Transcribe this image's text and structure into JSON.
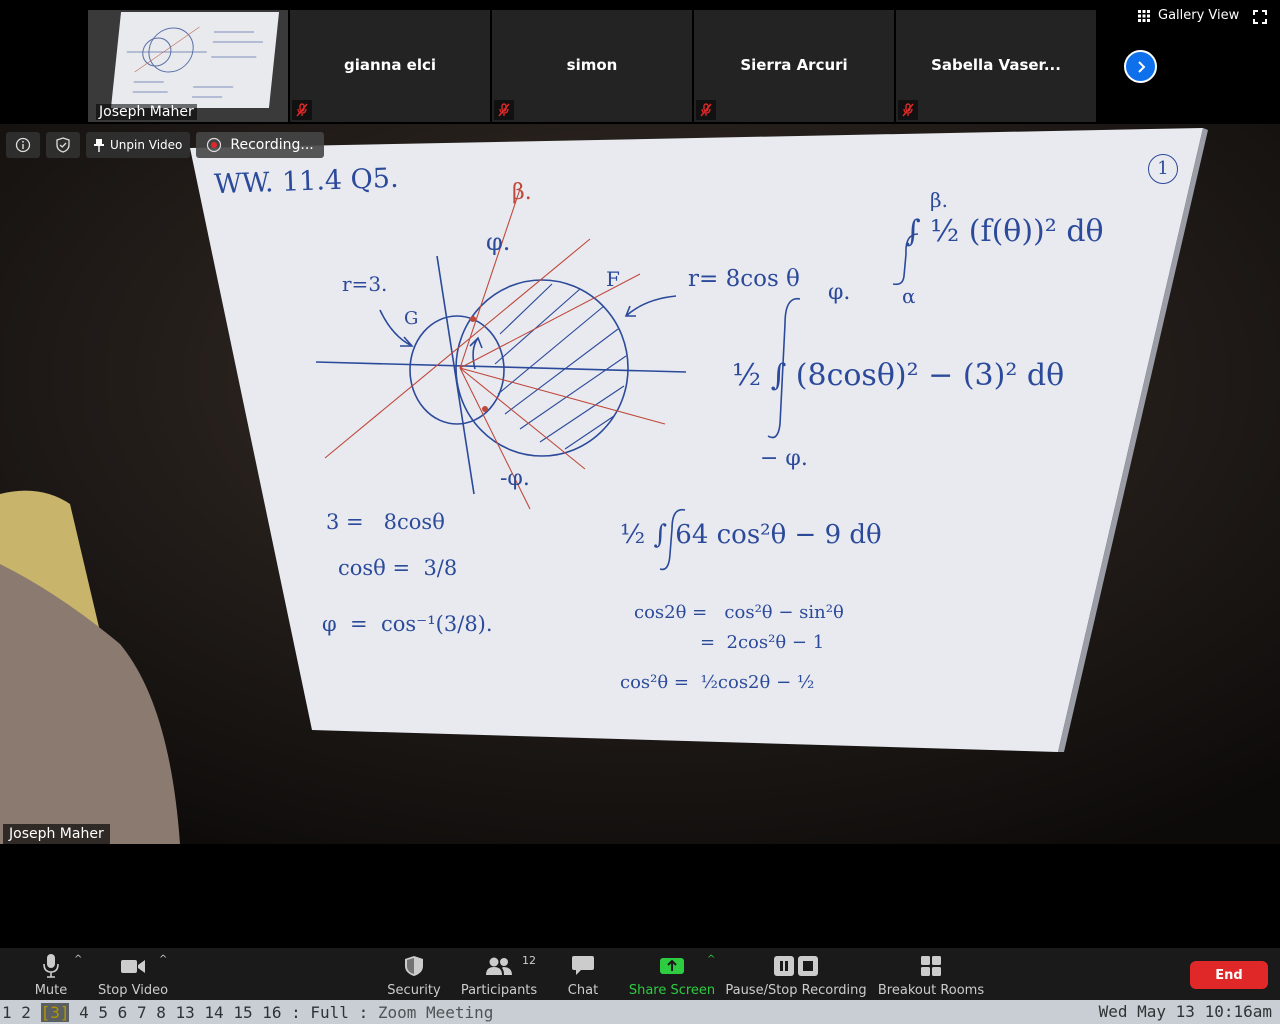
{
  "window": {
    "gallery_view_label": "Gallery View"
  },
  "thumbnails": [
    {
      "name": "Joseph Maher",
      "muted": false,
      "self": true
    },
    {
      "name": "gianna elci",
      "muted": true
    },
    {
      "name": "simon",
      "muted": true
    },
    {
      "name": "Sierra Arcuri",
      "muted": true
    },
    {
      "name": "Sabella Vaser...",
      "muted": true
    }
  ],
  "main_video": {
    "unpin_label": "Unpin Video",
    "recording_label": "Recording...",
    "speaker_name": "Joseph Maher"
  },
  "whiteboard": {
    "title": "WW. 11.4 Q5.",
    "page_number": "1",
    "label_r3": "r=3.",
    "label_G": "G",
    "label_F": "F",
    "label_r8cos": "r= 8cos θ",
    "label_beta": "β.",
    "label_phi_top": "φ.",
    "label_phi_bottom": "-φ.",
    "formula_area": "∫ ½ (f(θ))² dθ",
    "formula_beta": "β.",
    "formula_alpha": "α",
    "formula_integral_2": "½ ∫ (8cosθ)² − (3)² dθ",
    "limit_phi": "φ.",
    "limit_neg_phi": "− φ.",
    "formula_integral_3": "½ ∫ 64 cos²θ − 9  dθ",
    "eq1": "3 =   8cosθ",
    "eq2": "cosθ =  3/8",
    "eq3": "φ  =  cos⁻¹(3/8).",
    "id1": "cos2θ =   cos²θ − sin²θ",
    "id2": "=  2cos²θ − 1",
    "id3": "cos²θ =  ½cos2θ − ½"
  },
  "toolbar": {
    "mute_label": "Mute",
    "stop_video_label": "Stop Video",
    "security_label": "Security",
    "participants_label": "Participants",
    "participant_count": "12",
    "chat_label": "Chat",
    "share_screen_label": "Share Screen",
    "pause_recording_label": "Pause/Stop Recording",
    "breakout_label": "Breakout Rooms",
    "end_label": "End"
  },
  "statusbar": {
    "workspaces": [
      "1",
      "2",
      "3",
      "4",
      "5",
      "6",
      "7",
      "8",
      "13",
      "14",
      "15",
      "16"
    ],
    "active_workspace": "3",
    "mode": ": Full :",
    "title": "Zoom Meeting",
    "clock": "Wed May 13 10:16am"
  },
  "colors": {
    "accent_blue": "#0e71eb",
    "end_red": "#e02828",
    "share_green": "#2ecc40",
    "ink_blue": "#2c4a9a",
    "ink_red": "#c0483b"
  },
  "icons": [
    "gallery-grid-icon",
    "fullscreen-icon",
    "chevron-right-icon",
    "mic-muted-icon",
    "info-icon",
    "shield-icon",
    "pin-icon",
    "record-icon",
    "microphone-icon",
    "video-camera-icon",
    "security-shield-icon",
    "participants-icon",
    "chat-bubble-icon",
    "share-arrow-icon",
    "pause-stop-icon",
    "breakout-grid-icon"
  ]
}
